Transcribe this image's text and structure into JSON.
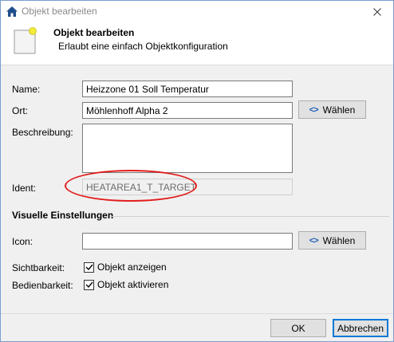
{
  "window": {
    "title": "Objekt bearbeiten"
  },
  "header": {
    "title": "Objekt bearbeiten",
    "subtitle": "Erlaubt eine einfach Objektkonfiguration"
  },
  "form": {
    "name_label": "Name:",
    "name_value": "Heizzone 01 Soll Temperatur",
    "ort_label": "Ort:",
    "ort_value": "Möhlenhoff Alpha 2",
    "ort_button": "Wählen",
    "beschreibung_label": "Beschreibung:",
    "beschreibung_value": "",
    "ident_label": "Ident:",
    "ident_value": "HEATAREA1_T_TARGET"
  },
  "visual": {
    "section_title": "Visuelle Einstellungen",
    "icon_label": "Icon:",
    "icon_value": "",
    "icon_button": "Wählen",
    "sichtbarkeit_label": "Sichtbarkeit:",
    "sichtbarkeit_checkbox": "Objekt anzeigen",
    "sichtbarkeit_checked": true,
    "bedienbarkeit_label": "Bedienbarkeit:",
    "bedienbarkeit_checkbox": "Objekt aktivieren",
    "bedienbarkeit_checked": true
  },
  "footer": {
    "ok": "OK",
    "cancel": "Abbrechen"
  },
  "icons": {
    "app": "house-icon",
    "close": "close-icon",
    "header": "document-icon",
    "choose": "code-brackets-icon",
    "check": "checkmark-icon"
  },
  "colors": {
    "accent": "#0078d7",
    "highlight": "#e21c1c",
    "app_icon": "#1f4e8c",
    "doc_badge": "#f2ea3a"
  }
}
